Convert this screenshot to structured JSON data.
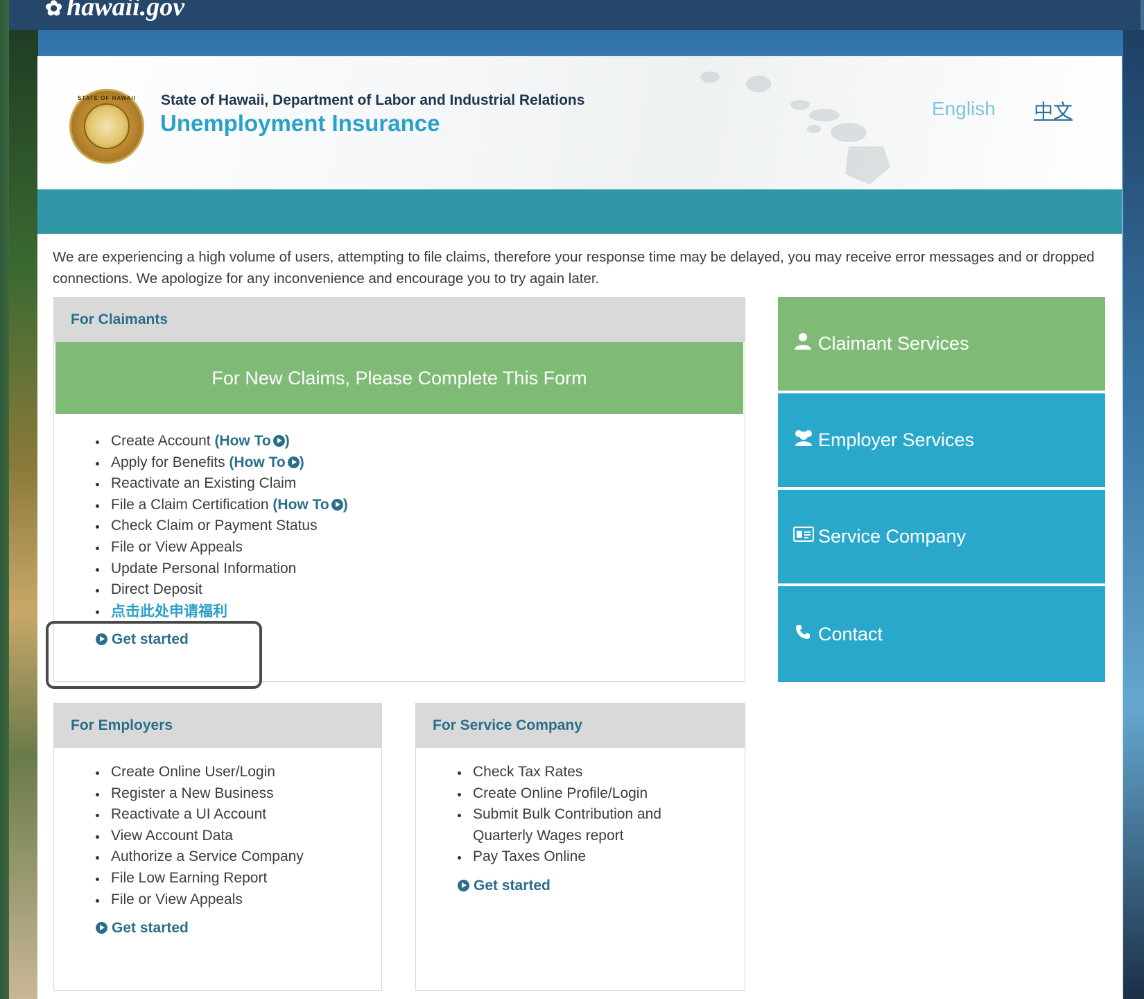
{
  "site": {
    "logo_text": "hawaii.gov"
  },
  "header": {
    "department": "State of Hawaii, Department of Labor and Industrial Relations",
    "title": "Unemployment Insurance",
    "seal_text": "STATE OF HAWAII",
    "languages": {
      "english": "English",
      "chinese": "中文"
    }
  },
  "notice": "We are experiencing a high volume of users, attempting to file claims, therefore your response time may be delayed, you may receive error messages and or dropped connections. We apologize for any inconvenience and encourage you to try again later.",
  "claimants": {
    "heading": "For Claimants",
    "banner": "For New Claims, Please Complete This Form",
    "items": [
      {
        "label": "Create Account",
        "howto": "(How To",
        "howto_end": ")"
      },
      {
        "label": "Apply for Benefits",
        "howto": "(How To",
        "howto_end": ")"
      },
      {
        "label": "Reactivate an Existing Claim"
      },
      {
        "label": "File a Claim Certification",
        "howto": "(How To",
        "howto_end": ")"
      },
      {
        "label": "Check Claim or Payment Status"
      },
      {
        "label": "File or View Appeals"
      },
      {
        "label": "Update Personal Information"
      },
      {
        "label": "Direct Deposit"
      },
      {
        "label": "点击此处申请福利"
      }
    ],
    "get_started": "Get started"
  },
  "employers": {
    "heading": "For Employers",
    "items": [
      "Create Online User/Login",
      "Register a New Business",
      "Reactivate a UI Account",
      "View Account Data",
      "Authorize a Service Company",
      "File Low Earning Report",
      "File or View Appeals"
    ],
    "get_started": "Get started"
  },
  "service_company": {
    "heading": "For Service Company",
    "items": [
      "Check Tax Rates",
      "Create Online Profile/Login",
      "Submit Bulk Contribution and Quarterly Wages report",
      "Pay Taxes Online"
    ],
    "get_started": "Get started"
  },
  "tiles": {
    "claimant": {
      "label": "Claimant Services",
      "icon": "user-icon"
    },
    "employer": {
      "label": "Employer Services",
      "icon": "users-icon"
    },
    "service": {
      "label": "Service Company",
      "icon": "id-card-icon"
    },
    "contact": {
      "label": "Contact",
      "icon": "phone-icon"
    }
  },
  "colors": {
    "topbar": "#24476a",
    "teal_bar": "#3097a6",
    "green": "#7fbb77",
    "blue": "#2aa8cc",
    "link": "#2a6f8a"
  }
}
